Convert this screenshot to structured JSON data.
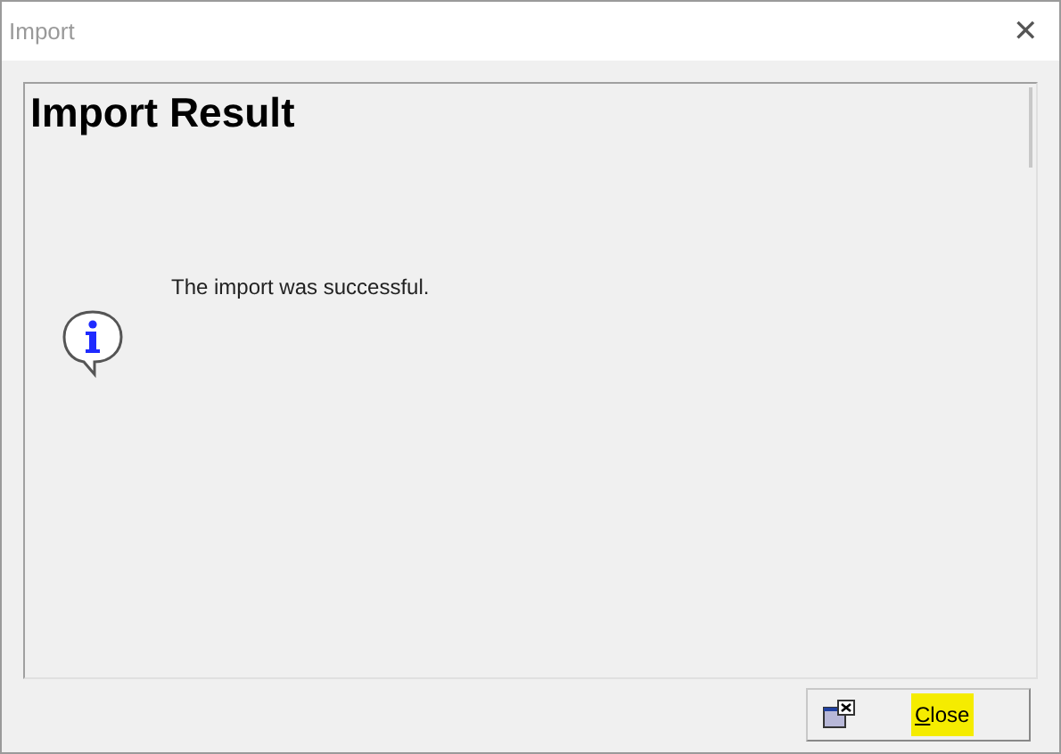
{
  "window": {
    "title": "Import",
    "close_glyph": "✕"
  },
  "heading": "Import Result",
  "message": "The import was successful.",
  "buttons": [
    {
      "label": "Close",
      "highlighted": true
    }
  ]
}
